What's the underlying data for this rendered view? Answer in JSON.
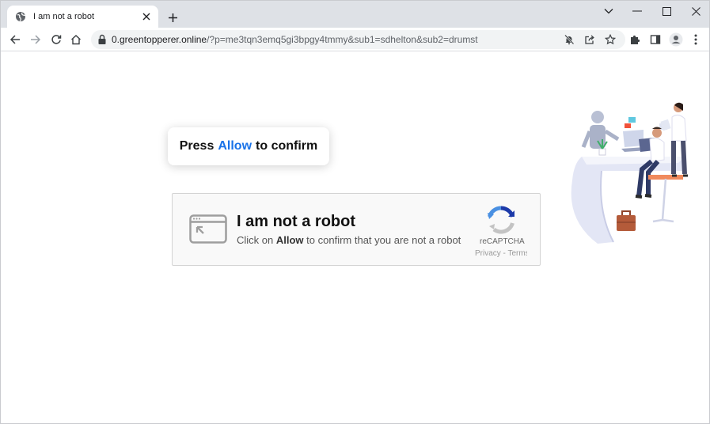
{
  "tab": {
    "title": "I am not a robot"
  },
  "address": {
    "host": "0.greentopperer.online",
    "path": "/?p=me3tqn3emq5gi3bpgy4tmmy&sub1=sdhelton&sub2=drumst"
  },
  "page": {
    "press_prefix": "Press",
    "press_allow": "Allow",
    "press_suffix": "to confirm",
    "captcha_title": "I am not a robot",
    "captcha_sub_prefix": "Click on",
    "captcha_sub_allow": "Allow",
    "captcha_sub_suffix": "to confirm that you are not a robot",
    "recaptcha_label": "reCAPTCHA",
    "privacy_terms": "Privacy - Terms"
  },
  "icons": {
    "back": "back-arrow-icon",
    "forward": "forward-arrow-icon",
    "reload": "reload-icon",
    "home": "home-icon",
    "lock": "lock-icon",
    "notifications_blocked": "bell-off-icon",
    "share": "share-icon",
    "bookmark": "star-icon",
    "extensions": "puzzle-icon",
    "side_panel": "side-panel-icon",
    "profile": "profile-icon",
    "menu": "kebab-menu-icon"
  },
  "colors": {
    "allow_blue": "#1a73e8",
    "tabstrip": "#dee1e6",
    "omnibox": "#f1f3f4"
  }
}
